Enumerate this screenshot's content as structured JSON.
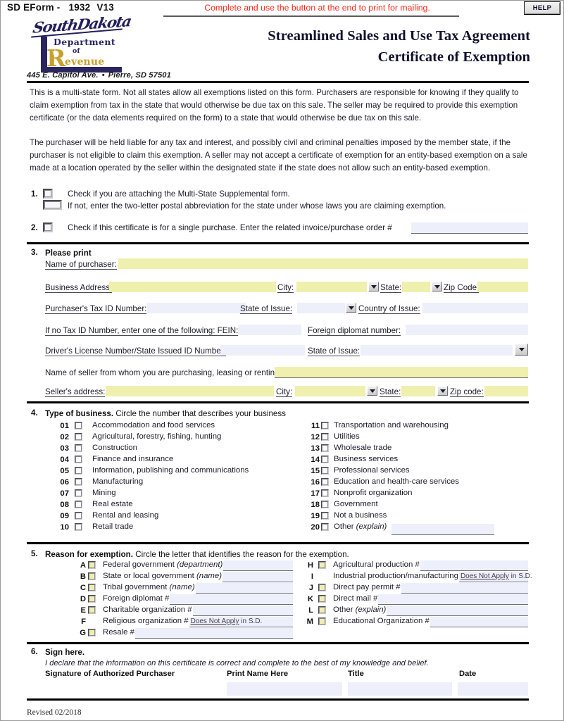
{
  "header": {
    "eform_prefix": "SD EForm -",
    "eform_number": "1932",
    "eform_version": "V13",
    "notice": "Complete and use the button at the end to print for mailing.",
    "help_label": "HELP",
    "logo": {
      "script": "SouthDakota",
      "department": "Department",
      "of": "of",
      "r": "R",
      "revenue": "evenue"
    },
    "address": "445 E. Capitol Ave.",
    "address_sep": "•",
    "address_city": "Pierre, SD 57501",
    "title_line1": "Streamlined Sales and Use Tax Agreement",
    "title_line2": "Certificate of Exemption"
  },
  "intro": {
    "paragraph1": "This is a multi-state form. Not all states allow all exemptions listed on this form. Purchasers are responsible for knowing if they qualify to claim exemption from tax in the state that would otherwise be due tax on this sale. The seller may be required to provide this exemption certificate (or the data elements required on the form) to a state that would otherwise be due tax on this sale.",
    "paragraph2": "The purchaser will be held liable for any tax and interest, and possibly civil and criminal penalties imposed by the member state, if the purchaser is not eligible to claim this exemption. A seller may not accept a certificate of exemption for an entity-based exemption on a sale made at a location operated by the seller within the designated state if the state does not allow such an entity-based exemption."
  },
  "item1": {
    "number": "1.",
    "line1": "Check if you are attaching the Multi-State Supplemental form.",
    "line2": "If not, enter the two-letter postal abbreviation for the state under whose laws you are claiming exemption.",
    "state_value": ""
  },
  "item2": {
    "number": "2.",
    "text": "Check if this certificate is for a single purchase. Enter the related invoice/purchase order #",
    "invoice_value": ""
  },
  "item3": {
    "number": "3.",
    "heading": "Please print",
    "name_of_purchaser_label": "Name of purchaser:",
    "name_of_purchaser_value": "",
    "business_address_label": "Business Address:",
    "business_address_value": "",
    "city_label": "City:",
    "city_value": "",
    "state_label": "State:",
    "state_value": "",
    "zip_label": "Zip Code:",
    "zip_value": "",
    "tax_id_label": "Purchaser's Tax ID Number:",
    "tax_id_value": "",
    "state_of_issue_label": "State of Issue:",
    "state_of_issue_value": "",
    "country_of_issue_label": "Country of Issue:",
    "country_of_issue_value": "",
    "no_tax_id_label": "If no Tax ID Number, enter one of the following:  FEIN:",
    "fein_value": "",
    "foreign_diplomat_label": "Foreign diplomat number:",
    "foreign_diplomat_value": "",
    "dl_label": "Driver's License Number/State Issued ID Number:",
    "dl_value": "",
    "dl_state_label": "State of Issue:",
    "dl_state_value": "",
    "seller_name_label": "Name of seller from whom you are purchasing, leasing or renting:",
    "seller_name_value": "",
    "seller_address_label": "Seller's address:",
    "seller_address_value": "",
    "seller_city_label": "City:",
    "seller_city_value": "",
    "seller_state_label": "State:",
    "seller_state_value": "",
    "seller_zip_label": "Zip code:",
    "seller_zip_value": ""
  },
  "item4": {
    "number": "4.",
    "heading": "Type of business.",
    "instruction": "Circle the number that describes your business",
    "left": [
      {
        "num": "01",
        "label": "Accommodation and food services"
      },
      {
        "num": "02",
        "label": "Agricultural, forestry, fishing, hunting"
      },
      {
        "num": "03",
        "label": "Construction"
      },
      {
        "num": "04",
        "label": "Finance and insurance"
      },
      {
        "num": "05",
        "label": "Information, publishing and communications"
      },
      {
        "num": "06",
        "label": "Manufacturing"
      },
      {
        "num": "07",
        "label": "Mining"
      },
      {
        "num": "08",
        "label": "Real estate"
      },
      {
        "num": "09",
        "label": "Rental and leasing"
      },
      {
        "num": "10",
        "label": "Retail trade"
      }
    ],
    "right": [
      {
        "num": "11",
        "label": "Transportation and warehousing"
      },
      {
        "num": "12",
        "label": "Utilities"
      },
      {
        "num": "13",
        "label": "Wholesale trade"
      },
      {
        "num": "14",
        "label": "Business services"
      },
      {
        "num": "15",
        "label": "Professional services"
      },
      {
        "num": "16",
        "label": "Education and health-care services"
      },
      {
        "num": "17",
        "label": "Nonprofit organization"
      },
      {
        "num": "18",
        "label": "Government"
      },
      {
        "num": "19",
        "label": "Not a business"
      },
      {
        "num": "20",
        "label": "Other",
        "italic": "(explain)"
      }
    ],
    "other_value": ""
  },
  "item5": {
    "number": "5.",
    "heading": "Reason for exemption.",
    "instruction": "Circle the letter that identifies the reason for the exemption.",
    "left": [
      {
        "letter": "A",
        "label": "Federal government",
        "italic": "(department)",
        "value": "",
        "checkbox": true
      },
      {
        "letter": "B",
        "label": "State or local government",
        "italic": "(name)",
        "value": "",
        "checkbox": true
      },
      {
        "letter": "C",
        "label": "Tribal government",
        "italic": "(name)",
        "value": "",
        "checkbox": true
      },
      {
        "letter": "D",
        "label": "Foreign diplomat #",
        "italic": "",
        "value": "",
        "checkbox": true
      },
      {
        "letter": "E",
        "label": "Charitable organization #",
        "italic": "",
        "value": "",
        "checkbox": true
      },
      {
        "letter": "F",
        "label": "Religious organization #",
        "italic": "",
        "value": "Does Not Apply in S.D.",
        "checkbox": false
      },
      {
        "letter": "G",
        "label": "Resale #",
        "italic": "",
        "value": "",
        "checkbox": true
      }
    ],
    "right": [
      {
        "letter": "H",
        "label": "Agricultural production #",
        "italic": "",
        "value": "",
        "checkbox": true
      },
      {
        "letter": "I",
        "label": "Industrial production/manufacturing",
        "italic": "",
        "value": "Does Not Apply in S.D.",
        "checkbox": false
      },
      {
        "letter": "J",
        "label": "Direct pay permit #",
        "italic": "",
        "value": "",
        "checkbox": true
      },
      {
        "letter": "K",
        "label": "Direct mail #",
        "italic": "",
        "value": "",
        "checkbox": true
      },
      {
        "letter": "L",
        "label": "Other",
        "italic": "(explain)",
        "value": "",
        "checkbox": true
      },
      {
        "letter": "M",
        "label": "Educational Organization #",
        "italic": "",
        "value": "",
        "checkbox": true
      }
    ]
  },
  "item6": {
    "number": "6.",
    "heading": "Sign here.",
    "declaration": "I declare that the information on this certificate is correct and complete to the best of my knowledge and belief.",
    "col_signature": "Signature of Authorized Purchaser",
    "col_print_name": "Print Name Here",
    "col_title": "Title",
    "col_date": "Date",
    "signature_value": "",
    "print_name_value": "",
    "title_value": "",
    "date_value": ""
  },
  "footer": {
    "revised": "Revised 02/2018"
  },
  "colors": {
    "yellow_field": "#eff0ae",
    "blue_field": "#edeffa",
    "notice_red": "#ff2b1c",
    "logo_navy": "#2b2560",
    "logo_gold": "#c8a02a"
  }
}
